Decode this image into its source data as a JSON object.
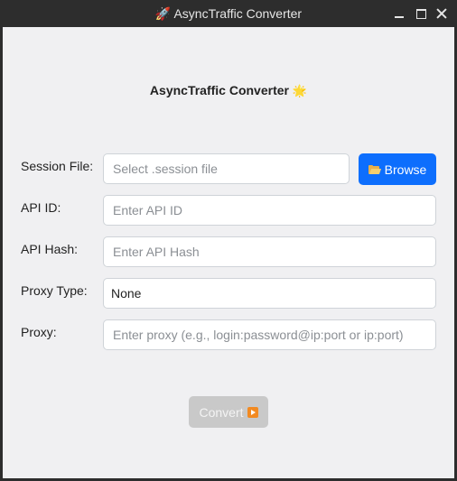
{
  "window": {
    "title": "🚀 AsyncTraffic Converter"
  },
  "header": {
    "title": "AsyncTraffic Converter",
    "icon": "🌟"
  },
  "form": {
    "session_file": {
      "label": "Session File:",
      "placeholder": "Select .session file",
      "value": ""
    },
    "browse_button": {
      "icon": "folder-open-icon",
      "label": "Browse"
    },
    "api_id": {
      "label": "API ID:",
      "placeholder": "Enter API ID",
      "value": ""
    },
    "api_hash": {
      "label": "API Hash:",
      "placeholder": "Enter API Hash",
      "value": ""
    },
    "proxy_type": {
      "label": "Proxy Type:",
      "value": "None"
    },
    "proxy": {
      "label": "Proxy:",
      "placeholder": "Enter proxy (e.g., login:password@ip:port or ip:port)",
      "value": ""
    }
  },
  "convert_button": {
    "label": "Convert",
    "icon": "play-button-icon",
    "enabled": false
  },
  "colors": {
    "accent": "#0d6efd",
    "disabled_button": "#c9c9c9",
    "background": "#f0f0f2",
    "titlebar": "#2d2d2d"
  }
}
